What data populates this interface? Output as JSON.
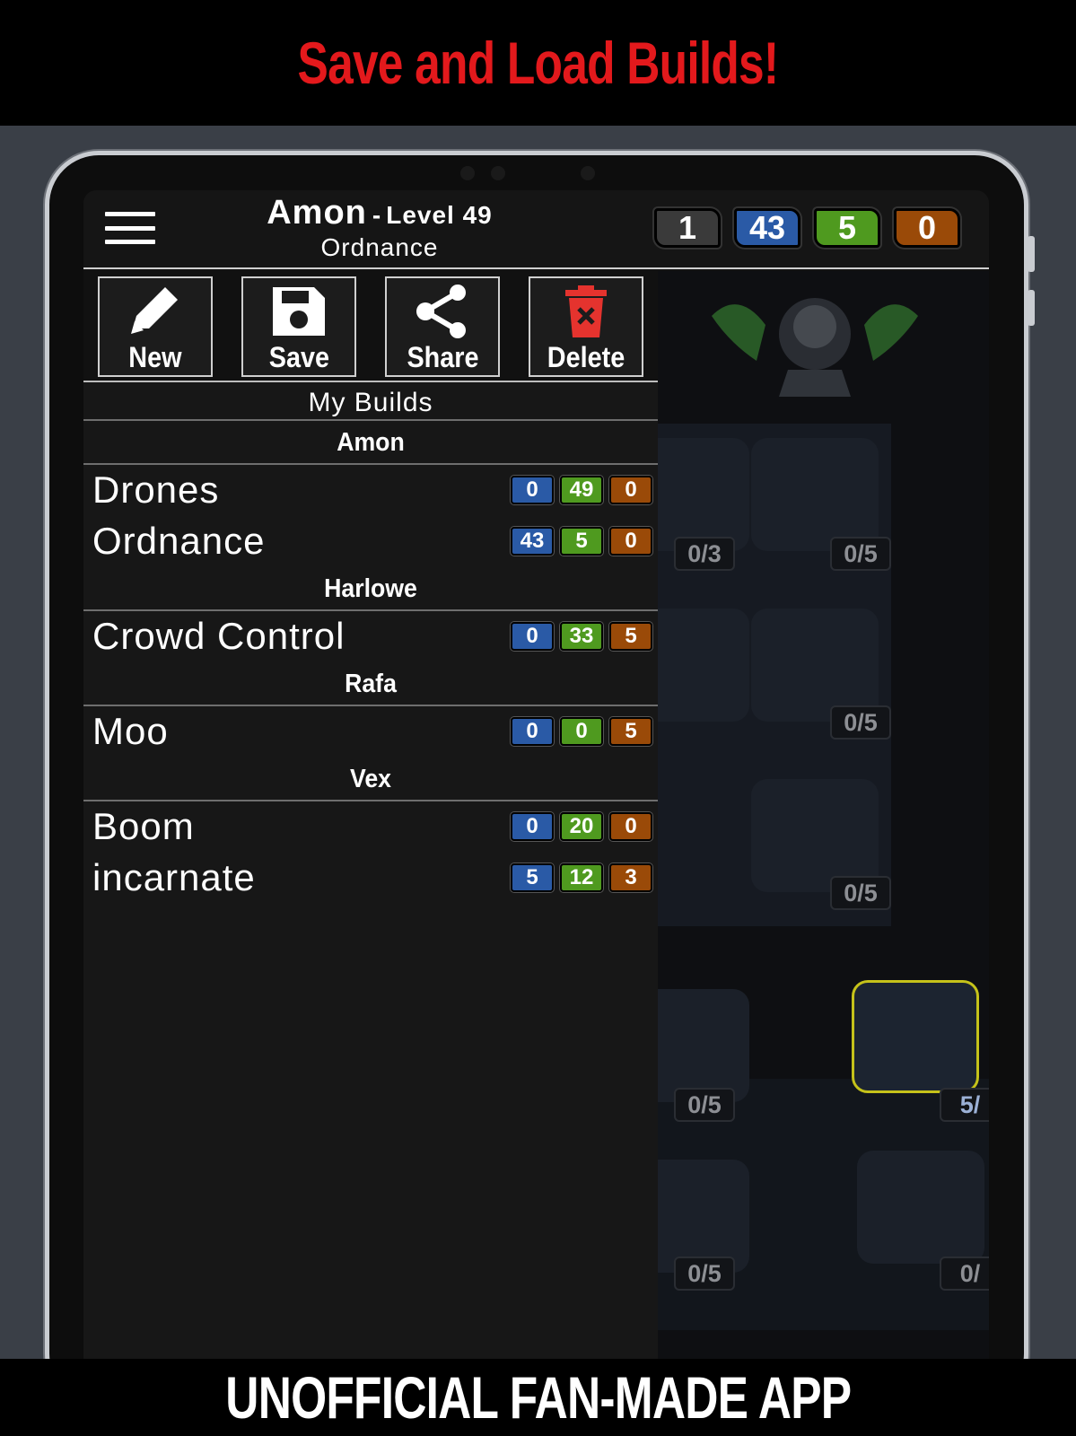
{
  "banner_top": "Save and Load Builds!",
  "banner_bottom": "UNOFFICIAL FAN-MADE APP",
  "colors": {
    "banner_red": "#e3191c",
    "blue": "#2a5aa6",
    "green": "#4f9a1f",
    "orange": "#9a4a08",
    "gray": "#3a3a3a"
  },
  "header": {
    "character": "Amon",
    "level_prefix": "-",
    "level": "Level 49",
    "spec": "Ordnance",
    "points": [
      {
        "value": "1",
        "color": "gray"
      },
      {
        "value": "43",
        "color": "blue"
      },
      {
        "value": "5",
        "color": "green"
      },
      {
        "value": "0",
        "color": "orange"
      }
    ]
  },
  "actions": [
    {
      "label": "New",
      "icon": "pencil-icon"
    },
    {
      "label": "Save",
      "icon": "floppy-disk-icon"
    },
    {
      "label": "Share",
      "icon": "share-icon"
    },
    {
      "label": "Delete",
      "icon": "trash-icon"
    }
  ],
  "my_builds_title": "My Builds",
  "groups": [
    {
      "title": "Amon",
      "builds": [
        {
          "name": "Drones",
          "points": [
            "0",
            "49",
            "0"
          ]
        },
        {
          "name": "Ordnance",
          "points": [
            "43",
            "5",
            "0"
          ]
        }
      ]
    },
    {
      "title": "Harlowe",
      "builds": [
        {
          "name": "Crowd Control",
          "points": [
            "0",
            "33",
            "5"
          ]
        }
      ]
    },
    {
      "title": "Rafa",
      "builds": [
        {
          "name": "Moo",
          "points": [
            "0",
            "0",
            "5"
          ]
        }
      ]
    },
    {
      "title": "Vex",
      "builds": [
        {
          "name": "Boom",
          "points": [
            "0",
            "20",
            "0"
          ]
        },
        {
          "name": "incarnate",
          "points": [
            "5",
            "12",
            "3"
          ]
        }
      ]
    }
  ],
  "skill_tiles": {
    "counts": [
      "0/3",
      "0/5",
      "0/5",
      "0/5",
      "0/5",
      "5/",
      "0/5",
      "0/"
    ]
  }
}
